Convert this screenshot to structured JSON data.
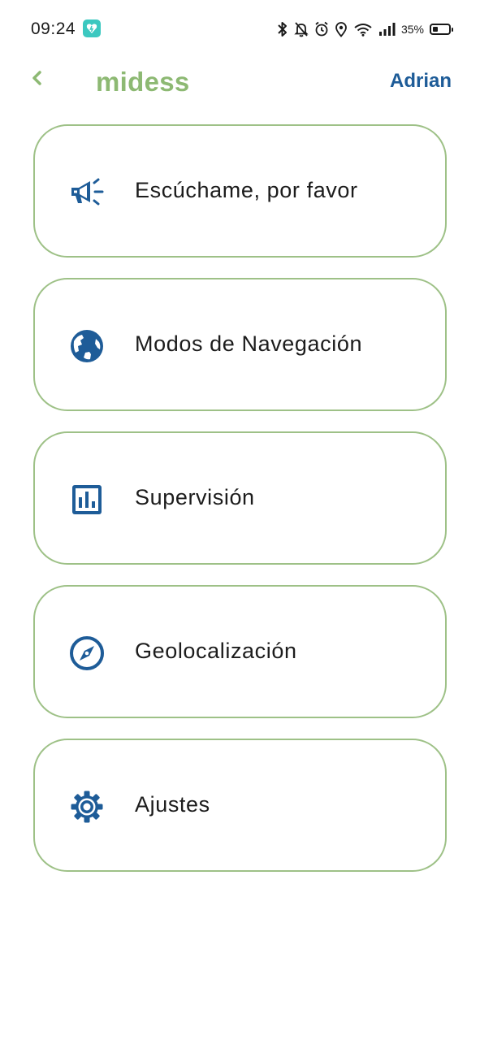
{
  "status_bar": {
    "time": "09:24",
    "battery_percent": "35%",
    "battery_level": 0.35,
    "icons": [
      "bluetooth-icon",
      "notifications-off-icon",
      "alarm-icon",
      "location-icon",
      "wifi-icon",
      "signal-icon",
      "battery-icon"
    ]
  },
  "header": {
    "back_icon": "chevron-left-icon",
    "title": "midess",
    "user": "Adrian"
  },
  "menu": {
    "items": [
      {
        "label": "Escúchame, por favor",
        "icon": "megaphone-icon"
      },
      {
        "label": "Modos de Navegación",
        "icon": "globe-icon"
      },
      {
        "label": "Supervisión",
        "icon": "bar-chart-icon"
      },
      {
        "label": "Geolocalización",
        "icon": "compass-icon"
      },
      {
        "label": "Ajustes",
        "icon": "gear-icon"
      }
    ]
  },
  "colors": {
    "brand_green": "#8db973",
    "card_border": "#9ec187",
    "icon_blue": "#1e5c98",
    "user_blue": "#1e5c98",
    "app_icon_teal": "#3cc8c0"
  }
}
